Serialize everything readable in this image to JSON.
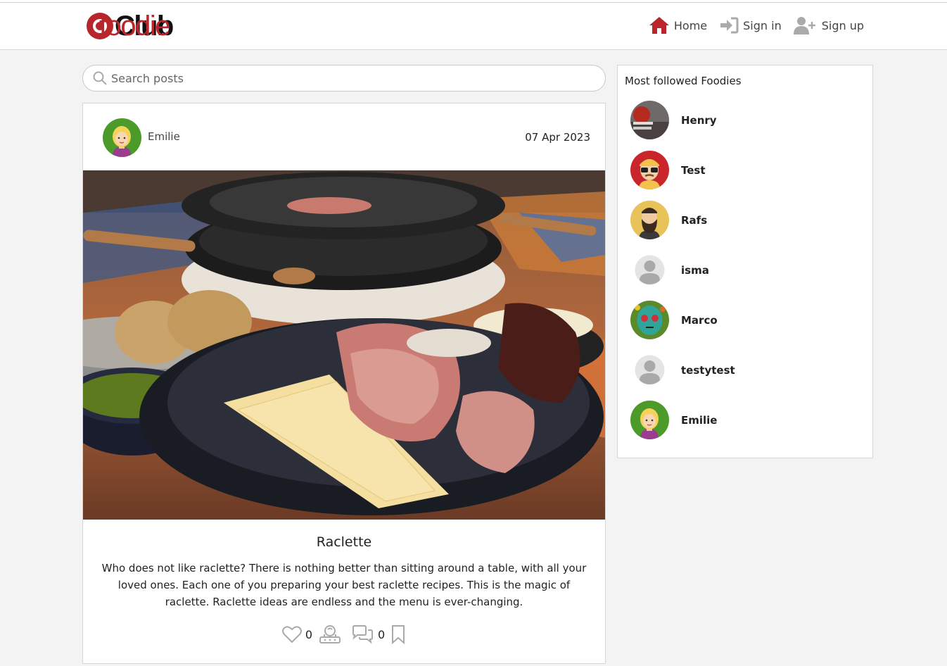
{
  "brand": {
    "name_part1": "foodie",
    "name_part2": "Club"
  },
  "nav": {
    "home": "Home",
    "sign_in": "Sign in",
    "sign_up": "Sign up"
  },
  "search": {
    "placeholder": "Search posts"
  },
  "post": {
    "author": "Emilie",
    "date": "07 Apr 2023",
    "title": "Raclette",
    "body": "Who does not like raclette? There is nothing better than sitting around a table, with all your loved ones. Each one of you preparing your best raclette recipes. This is the magic of raclette. Raclette ideas are endless and the menu is ever-changing.",
    "likes": "0",
    "comments": "0"
  },
  "sidebar": {
    "title": "Most followed Foodies",
    "foodies": [
      {
        "name": "Henry"
      },
      {
        "name": "Test"
      },
      {
        "name": "Rafs"
      },
      {
        "name": "isma"
      },
      {
        "name": "Marco"
      },
      {
        "name": "testytest"
      },
      {
        "name": "Emilie"
      }
    ]
  },
  "colors": {
    "brand_red": "#b8262b",
    "background": "#f3f3f3"
  }
}
